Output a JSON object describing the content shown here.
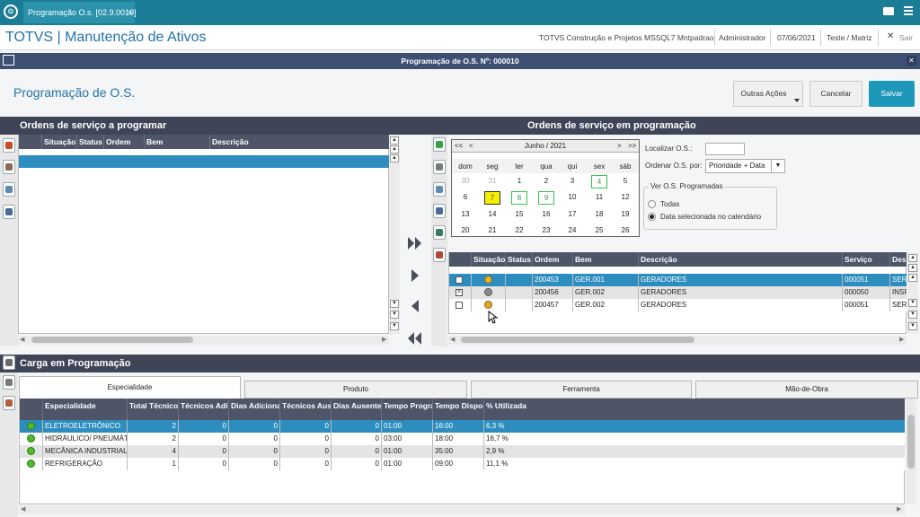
{
  "topbar": {
    "tab_label": "Programação O.s. [02.9.0019]",
    "tab_close": "×"
  },
  "header": {
    "app_title": "TOTVS | Manutenção de Ativos",
    "company": "TOTVS Construção e Projetos MSSQL7 Mntpadrao",
    "user": "Administrador",
    "date": "07/06/2021",
    "branch": "Teste / Matriz",
    "sair_label": "Sair",
    "sair_icon": "✕"
  },
  "dialog": {
    "title": "Programação de O.S. Nº: 000010",
    "page_title": "Programação de O.S.",
    "close": "✕",
    "btn_outras": "Outras Ações",
    "btn_cancelar": "Cancelar",
    "btn_salvar": "Salvar"
  },
  "left": {
    "section_title": "Ordens de serviço a programar",
    "columns": [
      "Situação",
      "Status",
      "Ordem",
      "Bem",
      "Descrição"
    ]
  },
  "right": {
    "section_title": "Ordens de serviço em programação",
    "calendar": {
      "prev_year": "<<",
      "prev": "<",
      "month": "Junho / 2021",
      "next": ">",
      "next_year": ">>",
      "days": [
        "dom",
        "seg",
        "ter",
        "qua",
        "qui",
        "sex",
        "sáb"
      ],
      "weeks": [
        [
          "30",
          "31",
          "1",
          "2",
          "3",
          "4",
          "5"
        ],
        [
          "6",
          "7",
          "8",
          "9",
          "10",
          "11",
          "12"
        ],
        [
          "13",
          "14",
          "15",
          "16",
          "17",
          "18",
          "19"
        ],
        [
          "20",
          "21",
          "22",
          "23",
          "24",
          "25",
          "26"
        ]
      ]
    },
    "localizar_label": "Localizar O.S.:",
    "localizar_value": "",
    "ordenar_label": "Ordenar O.S. por:",
    "ordenar_value": "Prioridade + Data",
    "ver_group": "Ver O.S. Programadas",
    "radio_todas": "Todas",
    "radio_data": "Data selecionada no calendário",
    "columns": [
      "Situação",
      "Status",
      "Ordem",
      "Bem",
      "Descrição",
      "Serviço",
      "Des"
    ],
    "rows": [
      {
        "ordem": "200453",
        "bem": "GER.001",
        "descricao": "GERADORES",
        "servico": "000051",
        "des": "SERV"
      },
      {
        "ordem": "200456",
        "bem": "GER.002",
        "descricao": "GERADORES",
        "servico": "000050",
        "des": "INSP"
      },
      {
        "ordem": "200457",
        "bem": "GER.002",
        "descricao": "GERADORES",
        "servico": "000051",
        "des": "SERV"
      }
    ],
    "row_status_colors": [
      "#f0b020",
      "#8a8a8a",
      "#f0a020"
    ]
  },
  "carga": {
    "section_title": "Carga em Programação",
    "tabs": [
      "Especialidade",
      "Produto",
      "Ferramenta",
      "Mão-de-Obra"
    ],
    "columns": [
      "Especialidade",
      "Total Técnicos",
      "Técnicos Adicionais",
      "Dias Adicionais",
      "Técnicos Ausentes",
      "Dias Ausentes",
      "Tempo Programado",
      "Tempo Disponível",
      "% Utilizada"
    ],
    "rows": [
      {
        "esp": "ELETROELETRÔNICO",
        "tt": "2",
        "ta": "0",
        "da": "0",
        "taus": "0",
        "daus": "0",
        "tp": "01:00",
        "td": "16:00",
        "pu": "6,3 %"
      },
      {
        "esp": "HIDRÁULICO/ PNEUMÁTI",
        "tt": "2",
        "ta": "0",
        "da": "0",
        "taus": "0",
        "daus": "0",
        "tp": "03:00",
        "td": "18:00",
        "pu": "16,7 %"
      },
      {
        "esp": "MECÂNICA INDUSTRIAL",
        "tt": "4",
        "ta": "0",
        "da": "0",
        "taus": "0",
        "daus": "0",
        "tp": "01:00",
        "td": "35:00",
        "pu": "2,9 %"
      },
      {
        "esp": "REFRIGERAÇÃO",
        "tt": "1",
        "ta": "0",
        "da": "0",
        "taus": "0",
        "daus": "0",
        "tp": "01:00",
        "td": "09:00",
        "pu": "11,1 %"
      }
    ]
  },
  "colors": {
    "topbar": "#1b7d95",
    "accent": "#2473a8",
    "selected_row": "#2d8dbf",
    "section_header": "#3f4556"
  }
}
